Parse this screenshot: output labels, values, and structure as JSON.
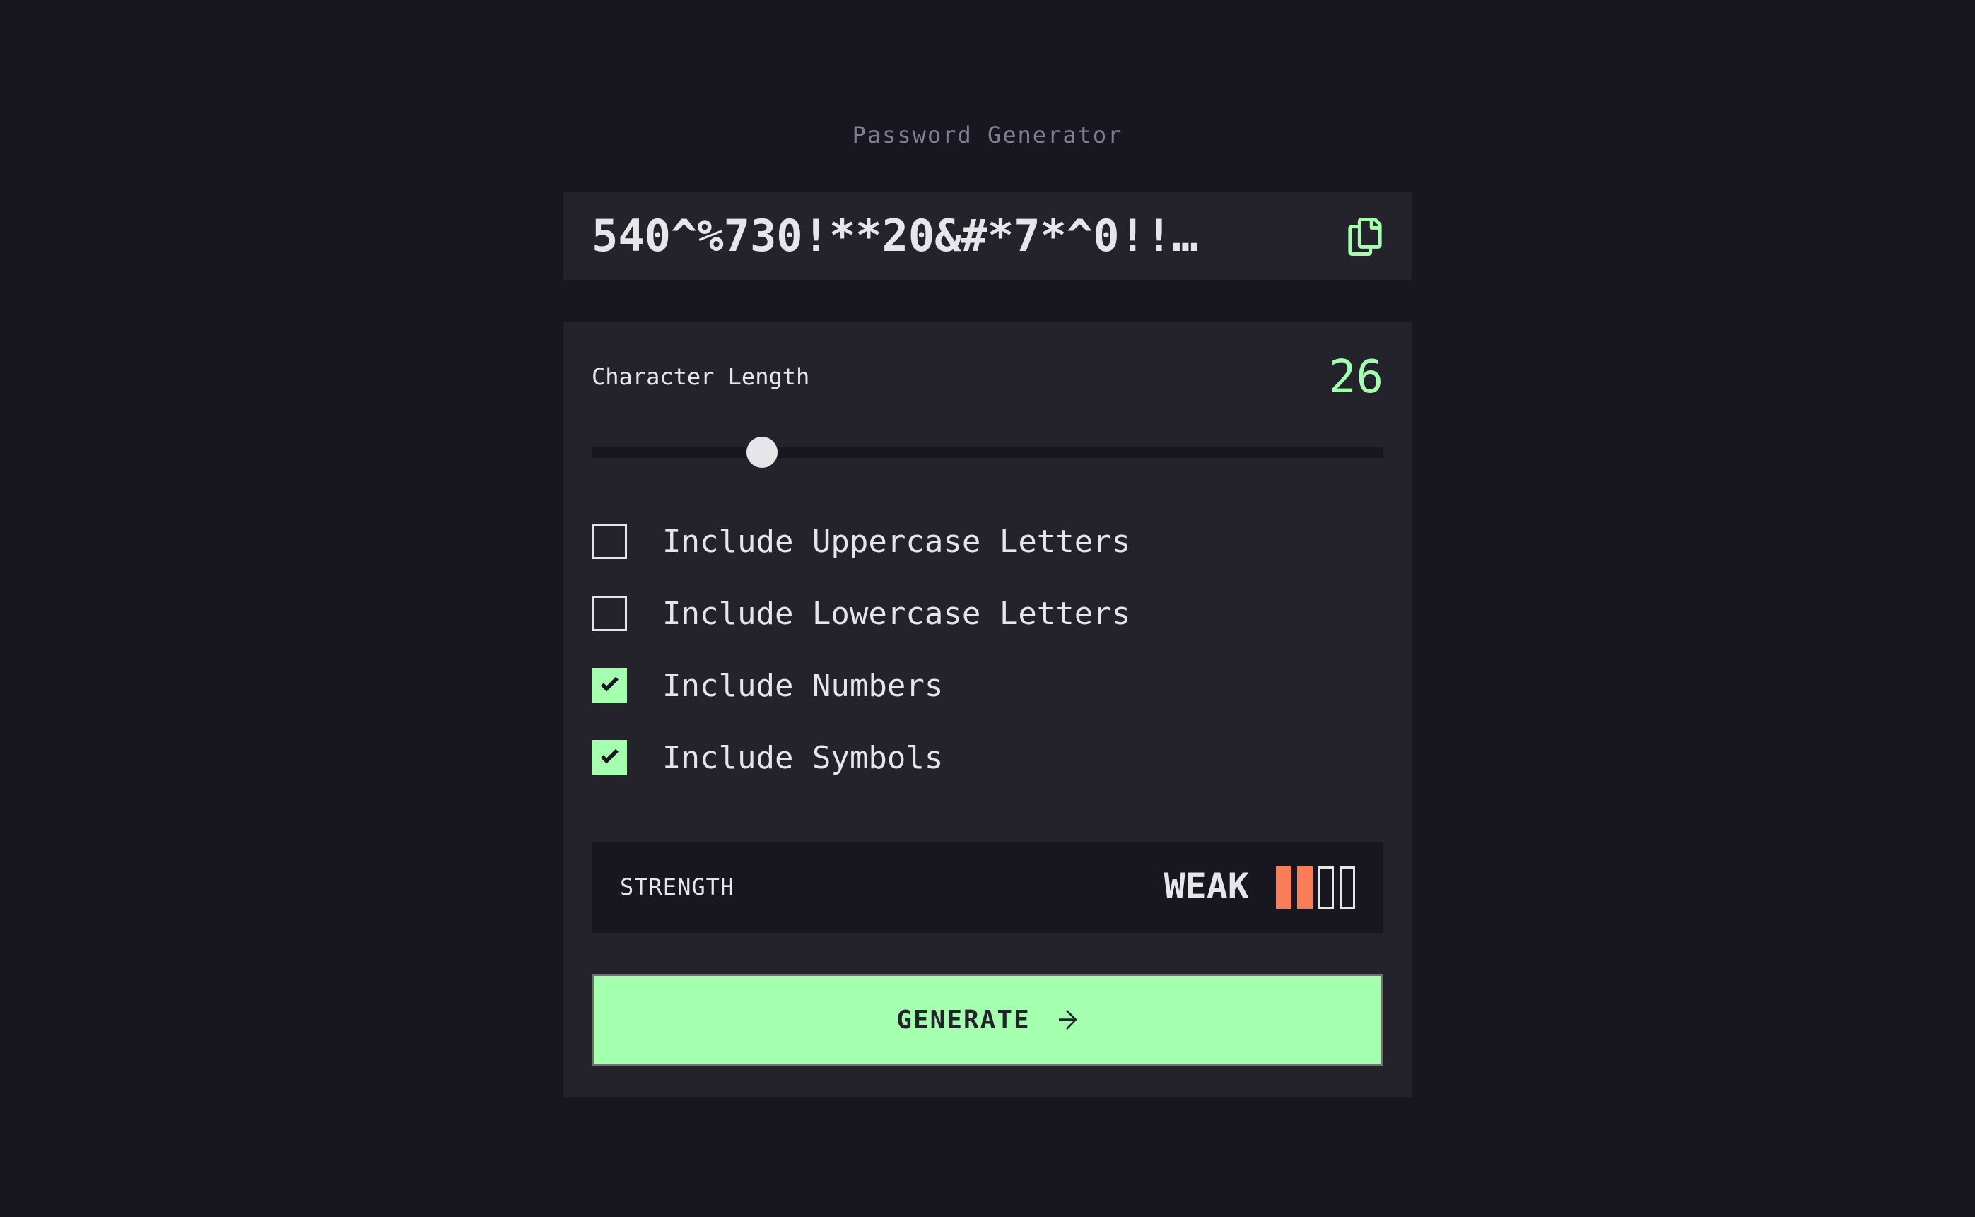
{
  "app": {
    "title": "Password Generator"
  },
  "password": {
    "value": "540^%730!**20&#*7*^0!!…",
    "copy_icon": "copy-icon"
  },
  "length": {
    "label": "Character Length",
    "value": "26",
    "slider_fraction": 0.215
  },
  "options": [
    {
      "label": "Include Uppercase Letters",
      "checked": false
    },
    {
      "label": "Include Lowercase Letters",
      "checked": false
    },
    {
      "label": "Include Numbers",
      "checked": true
    },
    {
      "label": "Include Symbols",
      "checked": true
    }
  ],
  "strength": {
    "label": "STRENGTH",
    "value": "WEAK",
    "bars_total": 4,
    "bars_filled": 2,
    "color": "#FB7C58"
  },
  "generate": {
    "label": "GENERATE",
    "icon": "arrow-right-icon"
  },
  "colors": {
    "accent": "#A4FFAF",
    "background": "#18171F",
    "panel": "#24232C",
    "text": "#E6E5EA",
    "muted": "#817D92"
  }
}
